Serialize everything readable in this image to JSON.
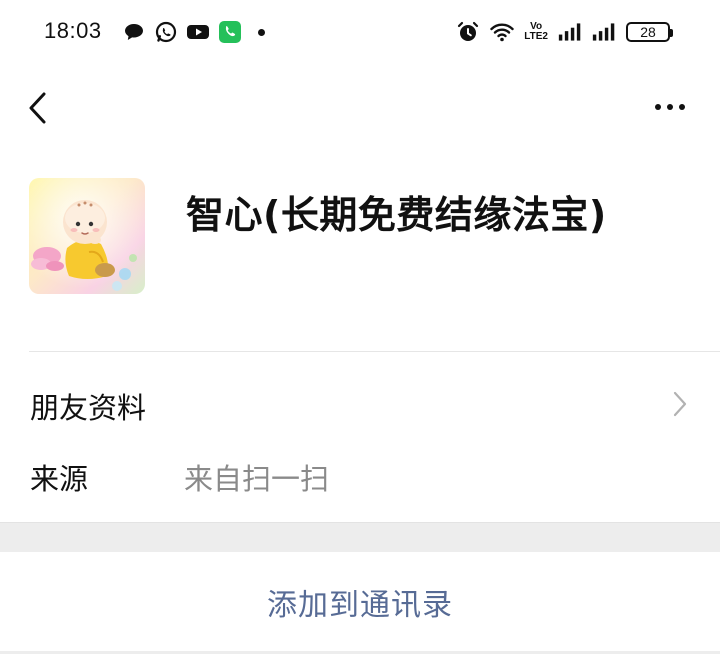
{
  "status_bar": {
    "time": "18:03",
    "left_icons": [
      "message-bubble-icon",
      "whatsapp-icon",
      "youtube-icon",
      "phone-call-icon",
      "notification-dot"
    ],
    "right_icons": [
      "alarm-icon",
      "wifi-icon",
      "volte-icon",
      "signal-icon",
      "signal-icon",
      "battery-icon"
    ],
    "volte_top": "Vo",
    "volte_bottom": "LTE2",
    "battery_level": "28"
  },
  "nav": {
    "back_icon": "chevron-left-icon",
    "more_icon": "more-horizontal-icon"
  },
  "profile": {
    "name": "智心(长期免费结缘法宝)",
    "avatar_icon": "cartoon-monk-avatar"
  },
  "info_rows": {
    "friend_info_label": "朋友资料",
    "source_label": "来源",
    "source_value": "来自扫一扫"
  },
  "actions": {
    "add_to_contacts": "添加到通讯录"
  },
  "colors": {
    "accent_link": "#576b95",
    "secondary_text": "#8a8a8a",
    "divider": "#e6e6e6",
    "band": "#ededed",
    "phone_green": "#25c05a",
    "youtube_dark": "#111111"
  }
}
